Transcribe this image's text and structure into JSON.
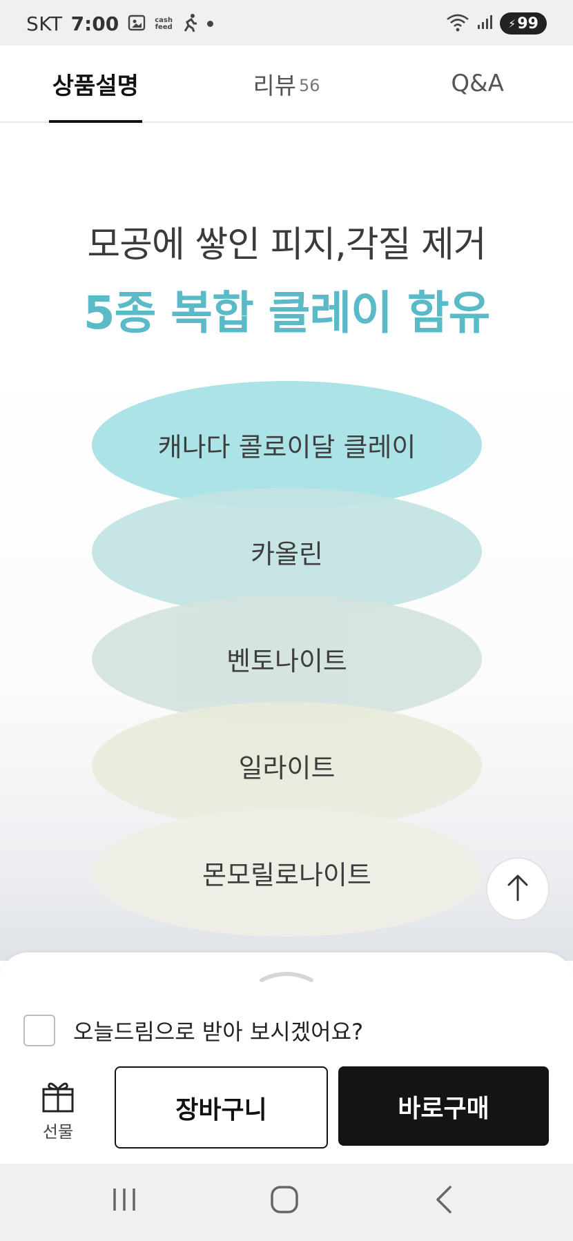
{
  "status_bar": {
    "carrier": "SKT",
    "time": "7:00",
    "cash_feed_line1": "cash",
    "cash_feed_line2": "feed",
    "battery": "99"
  },
  "tabs": [
    {
      "label": "상품설명",
      "active": true
    },
    {
      "label": "리뷰",
      "count": "56"
    },
    {
      "label": "Q&A"
    }
  ],
  "hero": {
    "line1": "모공에 쌓인 피지,각질 제거",
    "line2": "5종 복합 클레이 함유"
  },
  "clays": [
    {
      "label": "캐나다 콜로이달 클레이",
      "color": "#a6e1e6"
    },
    {
      "label": "카올린",
      "color": "#c3e3e4"
    },
    {
      "label": "벤토나이트",
      "color": "#d3e3df"
    },
    {
      "label": "일라이트",
      "color": "#e8ebdb"
    },
    {
      "label": "몬모릴로나이트",
      "color": "#f0efe6"
    }
  ],
  "accent_color": "#5bbac8",
  "sheet": {
    "gift_option_label": "오늘드림으로 받아 보시겠어요?",
    "gift_option_checked": false,
    "gift_label": "선물",
    "cart_button": "장바구니",
    "buy_button": "바로구매"
  },
  "icons": {
    "scroll_top": "arrow-up-icon",
    "gift": "gift-box-icon",
    "handle": "chevron-up-icon"
  }
}
